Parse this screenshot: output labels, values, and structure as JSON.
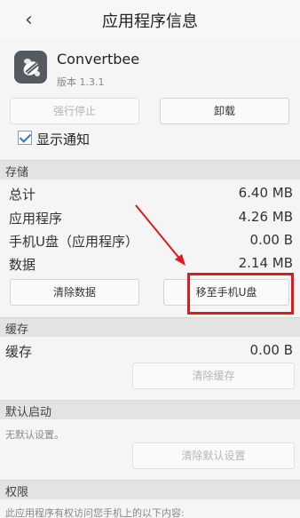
{
  "header": {
    "title": "应用程序信息",
    "back_icon": "chevron-left-icon"
  },
  "app": {
    "icon": "bee-icon",
    "name": "Convertbee",
    "version": "版本 1.3.1"
  },
  "actions": {
    "force_stop": "强行停止",
    "uninstall": "卸载"
  },
  "notification": {
    "label": "显示通知",
    "checked": true
  },
  "storage": {
    "title": "存储",
    "rows": [
      {
        "label": "总计",
        "value": "6.40 MB"
      },
      {
        "label": "应用程序",
        "value": "4.26 MB"
      },
      {
        "label": "手机U盘（应用程序）",
        "value": "0.00 B"
      },
      {
        "label": "数据",
        "value": "2.14 MB"
      }
    ],
    "clear_data": "清除数据",
    "move_to_usb": "移至手机U盘"
  },
  "cache": {
    "title": "缓存",
    "label": "缓存",
    "value": "0.00 B",
    "clear_cache": "清除缓存"
  },
  "default_launch": {
    "title": "默认启动",
    "hint": "无默认设置。",
    "clear_defaults": "清除默认设置"
  },
  "permissions": {
    "title": "权限",
    "hint": "此应用程序有权访问您手机上的以下内容:"
  },
  "annotation": {
    "color": "#e0191b"
  }
}
